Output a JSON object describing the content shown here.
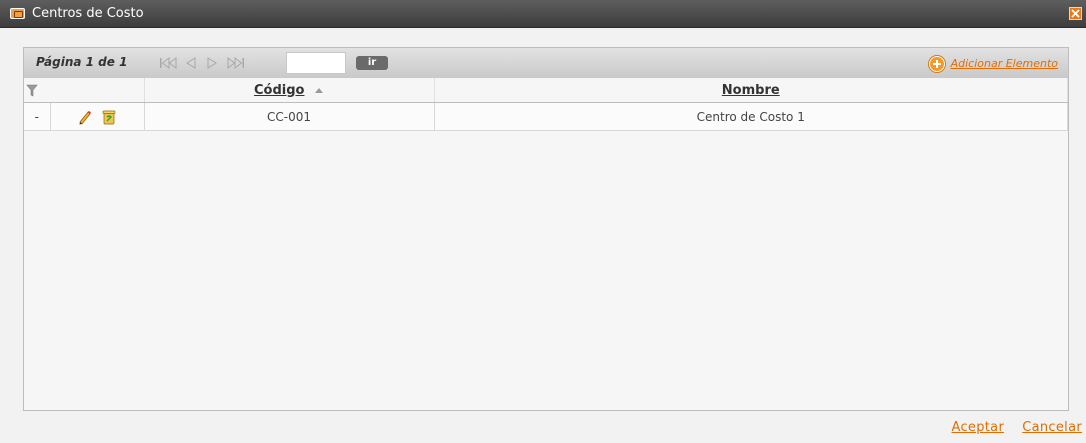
{
  "window": {
    "title": "Centros de Costo",
    "close_icon": "close-icon",
    "app_icon": "window-app-icon"
  },
  "toolbar": {
    "page_label": "Página 1 de 1",
    "go_label": "ir",
    "page_input_value": "",
    "add_label": "Adicionar Elemento",
    "add_icon": "plus-circle-icon"
  },
  "table": {
    "filter_icon": "filter-icon",
    "headers": {
      "codigo": "Código",
      "nombre": "Nombre"
    },
    "sort": {
      "column": "codigo",
      "direction": "ascending"
    },
    "rows": [
      {
        "marker": "-",
        "codigo": "CC-001",
        "nombre": "Centro de Costo 1"
      }
    ]
  },
  "footer": {
    "accept": "Aceptar",
    "cancel": "Cancelar"
  },
  "colors": {
    "accent": "#e56c00",
    "titlebar": "#4a4a4a",
    "background": "#f2f2f2"
  }
}
